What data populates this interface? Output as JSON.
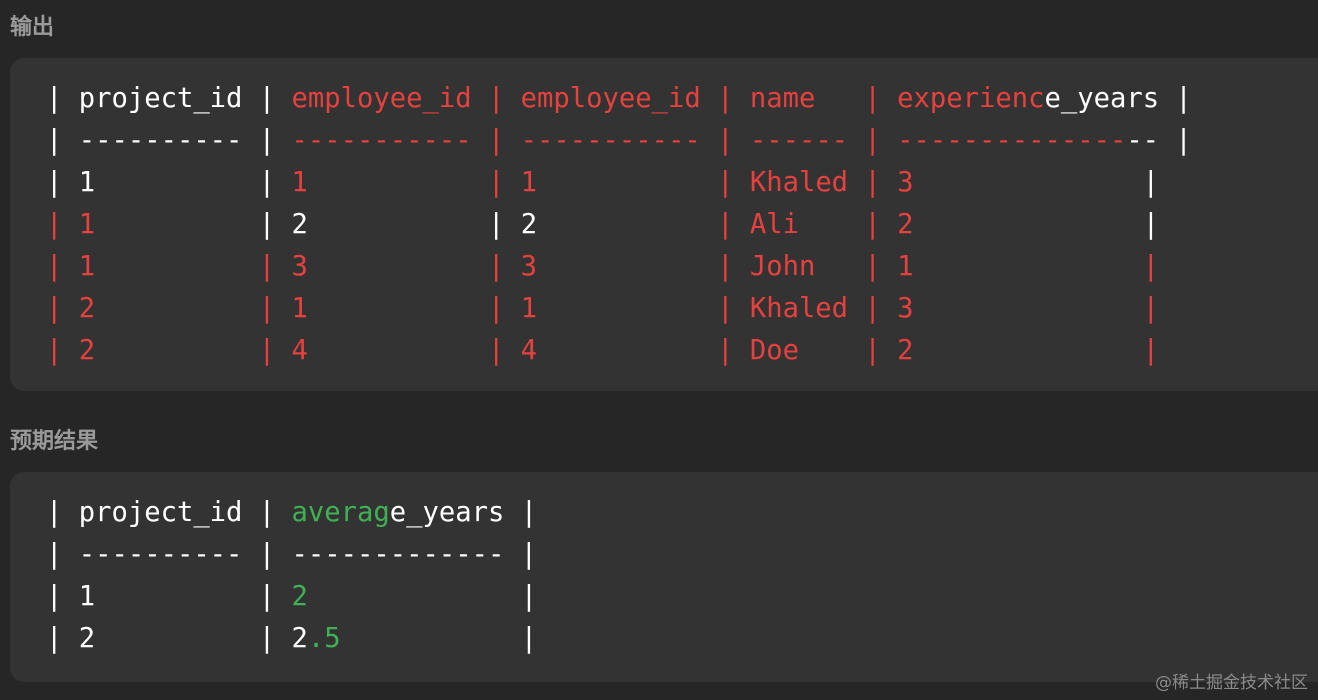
{
  "output": {
    "label": "输出",
    "lines": [
      [
        {
          "t": "| project_id | ",
          "c": "w"
        },
        {
          "t": "employee_id | employee_id | name   | experienc",
          "c": "r"
        },
        {
          "t": "e_years |",
          "c": "w"
        }
      ],
      [
        {
          "t": "| ---------- | ",
          "c": "w"
        },
        {
          "t": "----------- | ----------- | ------ | --------------",
          "c": "r"
        },
        {
          "t": "-- |",
          "c": "w"
        }
      ],
      [
        {
          "t": "| 1          | ",
          "c": "w"
        },
        {
          "t": "1           | 1           | Khaled | 3",
          "c": "r"
        },
        {
          "t": "              |",
          "c": "w"
        }
      ],
      [
        {
          "t": "| 1          ",
          "c": "r"
        },
        {
          "t": "| 2           | 2",
          "c": "w"
        },
        {
          "t": "           | Ali    | 2",
          "c": "r"
        },
        {
          "t": "              |",
          "c": "w"
        }
      ],
      [
        {
          "t": "| 1          | 3           | 3           | John   | 1              |",
          "c": "r"
        }
      ],
      [
        {
          "t": "| 2          | 1           | 1           | Khaled | 3              |",
          "c": "r"
        }
      ],
      [
        {
          "t": "| 2          | 4           | 4           | Doe    | 2              |",
          "c": "r"
        }
      ]
    ]
  },
  "expected": {
    "label": "预期结果",
    "lines": [
      [
        {
          "t": "| project_id | ",
          "c": "w"
        },
        {
          "t": "averag",
          "c": "g"
        },
        {
          "t": "e_years |",
          "c": "w"
        }
      ],
      [
        {
          "t": "| ---------- | ------------- |",
          "c": "w"
        }
      ],
      [
        {
          "t": "| 1          | ",
          "c": "w"
        },
        {
          "t": "2",
          "c": "g"
        },
        {
          "t": "             |",
          "c": "w"
        }
      ],
      [
        {
          "t": "| 2          | 2",
          "c": "w"
        },
        {
          "t": ".5",
          "c": "g"
        },
        {
          "t": "           |",
          "c": "w"
        }
      ]
    ]
  },
  "watermark": "@稀土掘金技术社区",
  "colors": {
    "white": "#ffffff",
    "red": "#e5413e",
    "green": "#3fb154",
    "panel": "#333333",
    "background": "#262626"
  }
}
